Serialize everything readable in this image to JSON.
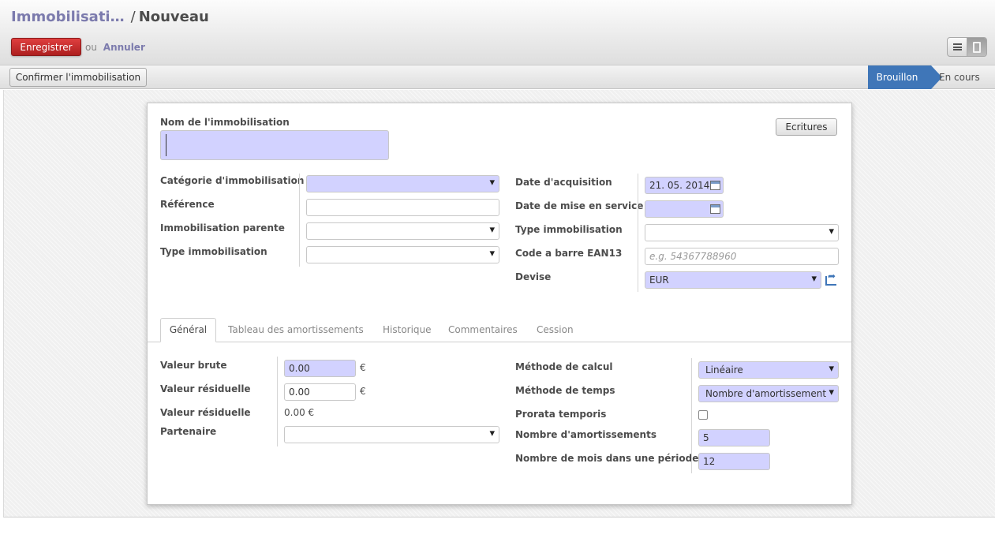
{
  "breadcrumb": {
    "parent": "Immobilisati…",
    "separator": "/",
    "current": "Nouveau"
  },
  "actions": {
    "save_label": "Enregistrer",
    "or_text": "ou",
    "cancel_label": "Annuler"
  },
  "view_switch": {
    "list_icon": "list-icon",
    "form_icon": "form-icon",
    "active": "form"
  },
  "statusbar": {
    "confirm_label": "Confirmer l'immobilisation",
    "states": [
      "Brouillon",
      "En cours"
    ],
    "current_state": "Brouillon"
  },
  "header": {
    "name_label": "Nom de l'immobilisation",
    "name_value": "",
    "entries_button": "Ecritures"
  },
  "left_group": {
    "category_label": "Catégorie d'immobilisation",
    "category_value": "",
    "reference_label": "Référence",
    "reference_value": "",
    "parent_label": "Immobilisation parente",
    "parent_value": "",
    "type_label": "Type immobilisation",
    "type_value": ""
  },
  "right_group": {
    "acq_date_label": "Date d'acquisition",
    "acq_date_value": "21. 05. 2014",
    "service_date_label": "Date de mise en service",
    "service_date_value": "",
    "type_label": "Type immobilisation",
    "type_value": "",
    "barcode_label": "Code a barre EAN13",
    "barcode_placeholder": "e.g. 54367788960",
    "currency_label": "Devise",
    "currency_value": "EUR"
  },
  "tabs": [
    {
      "label": "Général",
      "active": true
    },
    {
      "label": "Tableau des amortissements",
      "active": false
    },
    {
      "label": "Historique",
      "active": false
    },
    {
      "label": "Commentaires",
      "active": false
    },
    {
      "label": "Cession",
      "active": false
    }
  ],
  "general": {
    "gross_label": "Valeur brute",
    "gross_value": "0.00",
    "gross_currency": "€",
    "salvage_label": "Valeur résiduelle",
    "salvage_value": "0.00",
    "salvage_currency": "€",
    "residual_label": "Valeur résiduelle",
    "residual_value": "0.00 €",
    "partner_label": "Partenaire",
    "partner_value": "",
    "method_label": "Méthode de calcul",
    "method_value": "Linéaire",
    "time_label": "Méthode de temps",
    "time_value": "Nombre d'amortissement",
    "prorata_label": "Prorata temporis",
    "prorata_checked": false,
    "num_label": "Nombre d'amortissements",
    "num_value": "5",
    "period_label": "Nombre de mois dans une période",
    "period_value": "12"
  },
  "colors": {
    "accent": "#7c7bad",
    "save_button": "#c52a2a",
    "status_active": "#3f76b8",
    "required_field": "#d2d2ff"
  }
}
